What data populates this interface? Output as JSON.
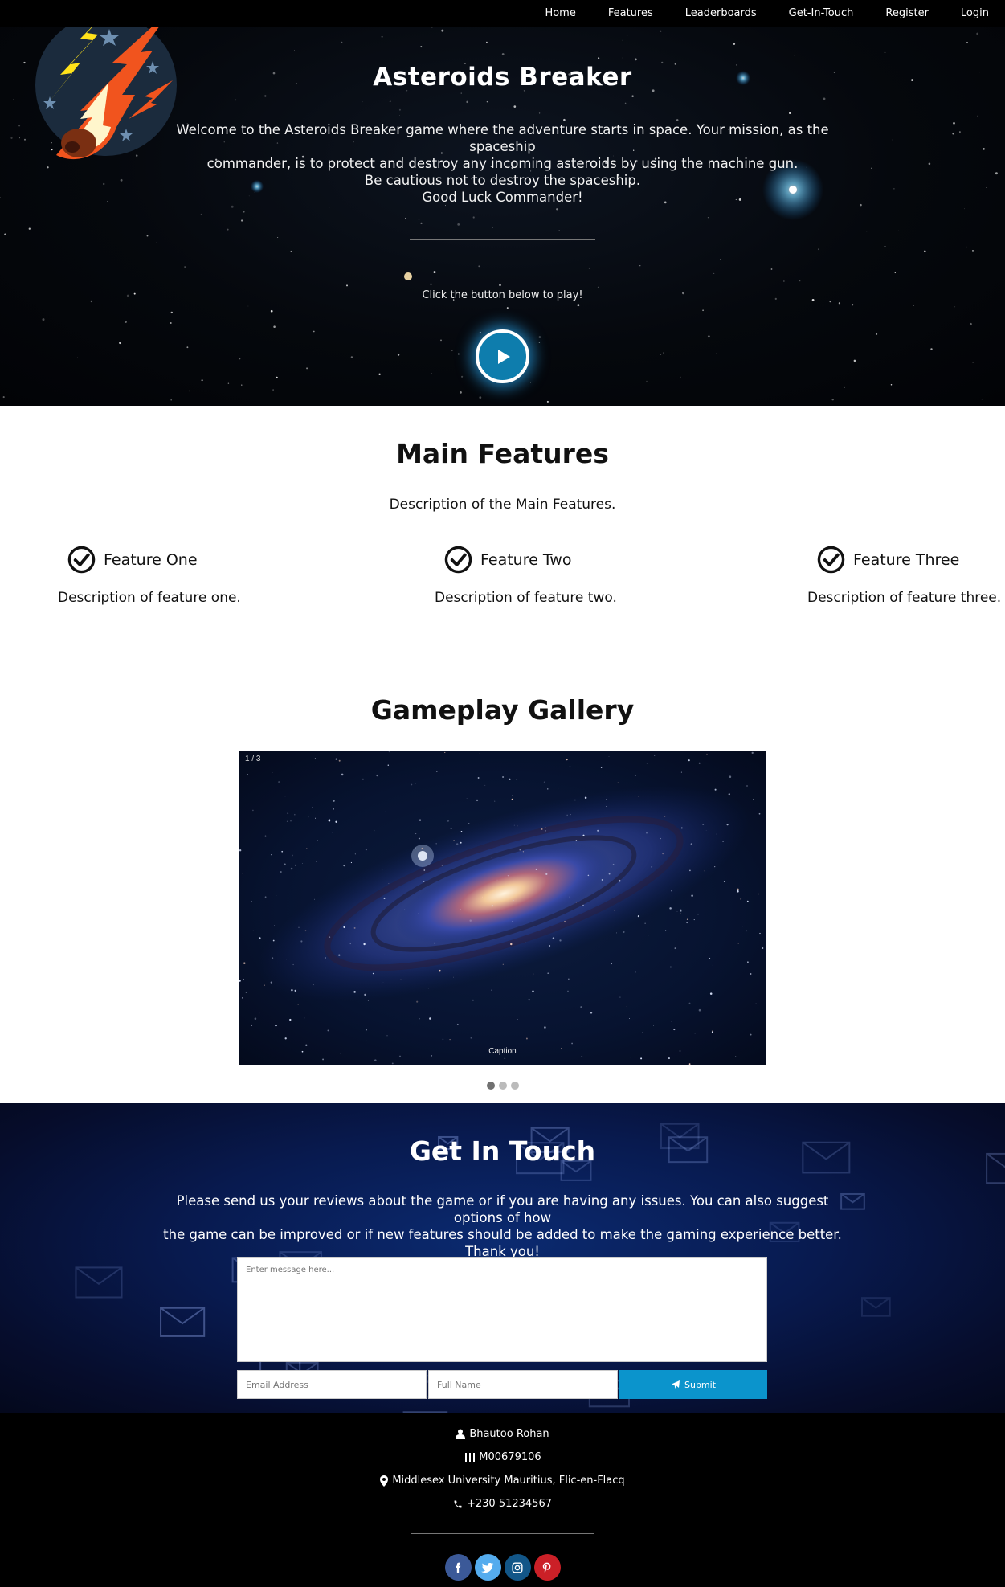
{
  "nav": {
    "items": [
      "Home",
      "Features",
      "Leaderboards",
      "Get-In-Touch",
      "Register",
      "Login"
    ]
  },
  "hero": {
    "title": "Asteroids Breaker",
    "lines": [
      "Welcome to the Asteroids Breaker game where the adventure starts in space. Your mission, as the spaceship",
      "commander, is to protect and destroy any incoming asteroids by using the machine gun.",
      "Be cautious not to destroy the spaceship.",
      "Good Luck Commander!"
    ],
    "click_text": "Click the button below to play!"
  },
  "features": {
    "title": "Main Features",
    "description": "Description of the Main Features.",
    "items": [
      {
        "name": "Feature One",
        "description": "Description of feature one."
      },
      {
        "name": "Feature Two",
        "description": "Description of feature two."
      },
      {
        "name": "Feature Three",
        "description": "Description of feature three."
      }
    ]
  },
  "gallery": {
    "title": "Gameplay Gallery",
    "slide_number": "1 / 3",
    "caption": "Caption",
    "slide_count": 3,
    "active_slide": 1
  },
  "contact": {
    "title": "Get In Touch",
    "lines": [
      "Please send us your reviews about the game or if you are having any issues. You can also suggest options of how",
      "the game can be improved or if new features should be added to make the gaming experience better.",
      "Thank you!"
    ],
    "message_placeholder": "Enter message here...",
    "email_placeholder": "Email Address",
    "name_placeholder": "Full Name",
    "submit_label": "Submit"
  },
  "footer": {
    "name": "Bhautoo Rohan",
    "student_id": "M00679106",
    "location": "Middlesex University Mauritius, Flic-en-Flacq",
    "phone": "+230 51234567",
    "social": [
      {
        "icon": "facebook-icon",
        "glyph": "f",
        "color": "#3b5998"
      },
      {
        "icon": "twitter-icon",
        "glyph": "t",
        "color": "#55acee"
      },
      {
        "icon": "instagram-icon",
        "glyph": "◎",
        "color": "#125688"
      },
      {
        "icon": "pinterest-icon",
        "glyph": "P",
        "color": "#cb2027"
      }
    ]
  },
  "colors": {
    "accent": "#0b94cc",
    "play_button": "#0e7dad"
  }
}
